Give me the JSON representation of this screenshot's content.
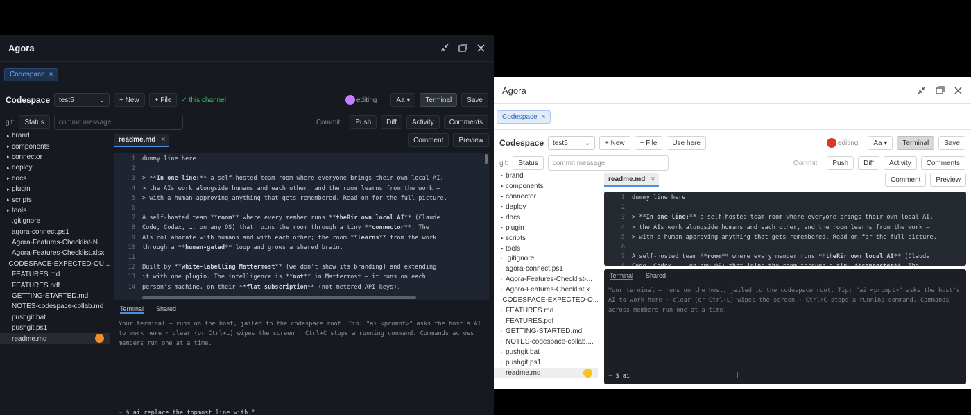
{
  "dark": {
    "title": "Agora",
    "tab": {
      "label": "Codespace"
    },
    "toolbar": {
      "label": "Codespace",
      "select_value": "test5",
      "new_label": "+ New",
      "file_label": "+ File",
      "channel_status": "✓ this channel",
      "editing": "editing",
      "font_label": "Aa",
      "terminal_label": "Terminal",
      "save_label": "Save"
    },
    "git": {
      "label": "git:",
      "status_label": "Status",
      "commit_placeholder": "commit message",
      "commit_label": "Commit",
      "push_label": "Push",
      "diff_label": "Diff",
      "activity_label": "Activity",
      "comments_label": "Comments"
    },
    "files": [
      "brand",
      "components",
      "connector",
      "deploy",
      "docs",
      "plugin",
      "scripts",
      "tools",
      ".gitignore",
      "agora-connect.ps1",
      "Agora-Features-Checklist-N...",
      "Agora-Features-Checklist.xlsx",
      "CODESPACE-EXPECTED-OU...",
      "FEATURES.md",
      "FEATURES.pdf",
      "GETTING-STARTED.md",
      "NOTES-codespace-collab.md",
      "pushgit.bat",
      "pushgit.ps1",
      "readme.md"
    ],
    "file_tab": "readme.md",
    "comment_label": "Comment",
    "preview_label": "Preview",
    "terminal": {
      "tab_terminal": "Terminal",
      "tab_shared": "Shared",
      "message": "Your terminal — runs on the host, jailed to the codespace root. Tip: \"ai <prompt>\" asks the host's AI to work here · clear (or Ctrl+L) wipes the screen · Ctrl+C stops a running command. Commands across members run one at a time.",
      "prompt": "~ $ ai replace the topmost line with \""
    }
  },
  "light": {
    "title": "Agora",
    "tab": {
      "label": "Codespace"
    },
    "toolbar": {
      "label": "Codespace",
      "select_value": "test5",
      "new_label": "+ New",
      "file_label": "+ File",
      "use_here_label": "Use here",
      "editing": "editing",
      "font_label": "Aa",
      "terminal_label": "Terminal",
      "save_label": "Save"
    },
    "git": {
      "label": "git:",
      "status_label": "Status",
      "commit_placeholder": "commit message",
      "commit_label": "Commit",
      "push_label": "Push",
      "diff_label": "Diff",
      "activity_label": "Activity",
      "comments_label": "Comments"
    },
    "files": [
      "brand",
      "components",
      "connector",
      "deploy",
      "docs",
      "plugin",
      "scripts",
      "tools",
      ".gitignore",
      "agora-connect.ps1",
      "Agora-Features-Checklist-...",
      "Agora-Features-Checklist.x...",
      "CODESPACE-EXPECTED-O...",
      "FEATURES.md",
      "FEATURES.pdf",
      "GETTING-STARTED.md",
      "NOTES-codespace-collab....",
      "pushgit.bat",
      "pushgit.ps1",
      "readme.md"
    ],
    "file_tab": "readme.md",
    "comment_label": "Comment",
    "preview_label": "Preview",
    "terminal": {
      "tab_terminal": "Terminal",
      "tab_shared": "Shared",
      "message": "Your terminal — runs on the host, jailed to the codespace root. Tip: \"ai <prompt>\" asks the host's AI to work here · clear (or Ctrl+L) wipes the screen · Ctrl+C stops a running command. Commands across members run one at a time.",
      "prompt": "~ $ ai"
    }
  },
  "code_lines": [
    {
      "n": "1",
      "t": "dummy line here"
    },
    {
      "n": "2",
      "t": ""
    },
    {
      "n": "3",
      "t": "> **In one line:** a self-hosted team room where everyone brings their own local AI,"
    },
    {
      "n": "4",
      "t": "> the AIs work alongside humans and each other, and the room learns from the work —"
    },
    {
      "n": "5",
      "t": "> with a human approving anything that gets remembered. Read on for the full picture."
    },
    {
      "n": "6",
      "t": ""
    },
    {
      "n": "7",
      "t": "A self-hosted team **room** where every member runs **theRir own local AI** (Claude"
    },
    {
      "n": "8",
      "t": "Code, Codex, …, on any OS) that joins the room through a tiny **connector**. The"
    },
    {
      "n": "9",
      "t": "AIs collaborate with humans and with each other; the room **learns** from the work"
    },
    {
      "n": "10",
      "t": "through a **human-gated** loop and grows a shared brain."
    },
    {
      "n": "11",
      "t": ""
    },
    {
      "n": "12",
      "t": "Built by **white-labelling Mattermost** (we don't show its branding) and extending"
    },
    {
      "n": "13",
      "t": "it with one plugin. The intelligence is **not** in Mattermost — it runs on each"
    },
    {
      "n": "14",
      "t": "person's machine, on their **flat subscription** (not metered API keys)."
    }
  ],
  "colors": {
    "dark_bg": "#16191f",
    "accent": "#4a90e2",
    "ok_green": "#3fbf6b",
    "dark_editing_dot": "#c77dff",
    "light_editing_dot": "#d63a2b",
    "avatar_orange": "#f08c2e",
    "avatar_yellow": "#f5c518"
  }
}
